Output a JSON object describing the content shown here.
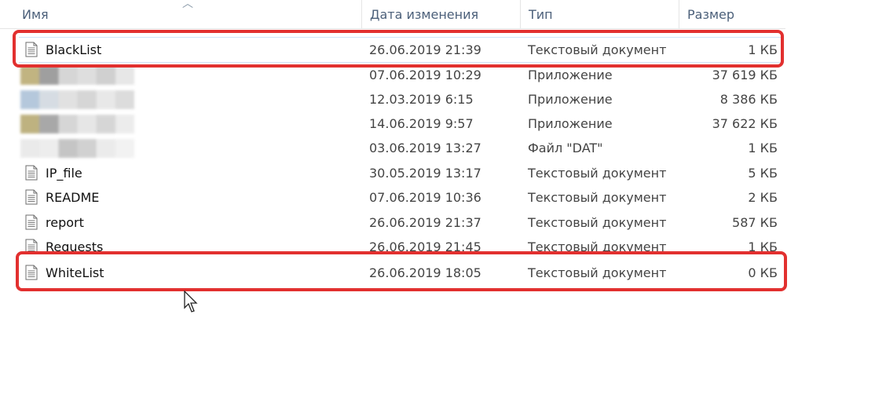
{
  "header": {
    "name": "Имя",
    "date": "Дата изменения",
    "type": "Тип",
    "size": "Размер"
  },
  "rows": [
    {
      "name": "BlackList",
      "date": "26.06.2019 21:39",
      "type": "Текстовый документ",
      "size": "1 КБ",
      "icon": "text-file-icon"
    },
    {
      "name": "",
      "date": "07.06.2019 10:29",
      "type": "Приложение",
      "size": "37 619 КБ",
      "icon": "blurred-app-icon"
    },
    {
      "name": "",
      "date": "12.03.2019 6:15",
      "type": "Приложение",
      "size": "8 386 КБ",
      "icon": "blurred-app-icon"
    },
    {
      "name": "",
      "date": "14.06.2019 9:57",
      "type": "Приложение",
      "size": "37 622 КБ",
      "icon": "blurred-app-icon"
    },
    {
      "name": "",
      "date": "03.06.2019 13:27",
      "type": "Файл \"DAT\"",
      "size": "1 КБ",
      "icon": "blurred-file-icon"
    },
    {
      "name": "IP_file",
      "date": "30.05.2019 13:17",
      "type": "Текстовый документ",
      "size": "5 КБ",
      "icon": "text-file-icon"
    },
    {
      "name": "README",
      "date": "07.06.2019 10:36",
      "type": "Текстовый документ",
      "size": "2 КБ",
      "icon": "text-file-icon"
    },
    {
      "name": "report",
      "date": "26.06.2019 21:37",
      "type": "Текстовый документ",
      "size": "587 КБ",
      "icon": "text-file-icon"
    },
    {
      "name": "Requests",
      "date": "26.06.2019 21:45",
      "type": "Текстовый документ",
      "size": "1 КБ",
      "icon": "text-file-icon"
    },
    {
      "name": "WhiteList",
      "date": "26.06.2019 18:05",
      "type": "Текстовый документ",
      "size": "0 КБ",
      "icon": "text-file-icon"
    }
  ],
  "colors": {
    "highlight": "#e2302f",
    "header_text": "#4c607a"
  }
}
